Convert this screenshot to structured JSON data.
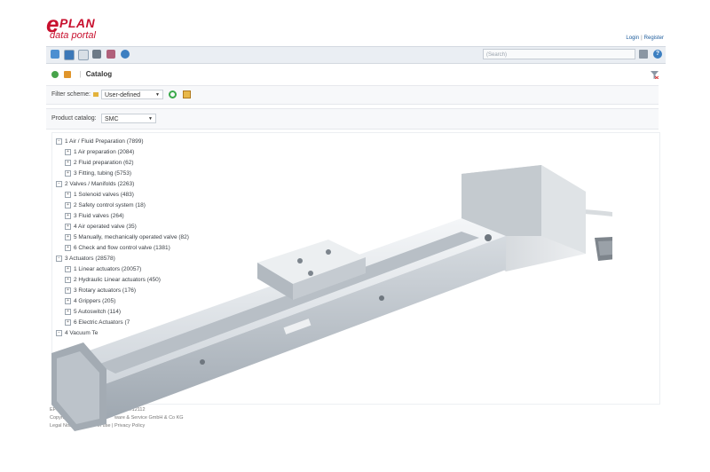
{
  "brand": {
    "logo_e": "e",
    "logo_plan": "PLAN",
    "logo_sub": "data portal"
  },
  "auth": {
    "login": "Login",
    "register": "Register"
  },
  "toolbar": {
    "icons": [
      "chart-icon",
      "catalog-icon",
      "table-icon",
      "binoculars-icon",
      "factory-icon",
      "info-icon"
    ],
    "search_placeholder": "(Search)",
    "help_label": "?"
  },
  "breadcrumb": {
    "current": "Catalog"
  },
  "filter": {
    "label": "Filter scheme:",
    "value": "User-defined"
  },
  "product_catalog": {
    "label": "Product catalog:",
    "value": "SMC"
  },
  "tree": [
    {
      "label": "1 Air / Fluid Preparation (7899)",
      "level": 0,
      "box": "−"
    },
    {
      "label": "1 Air preparation (2084)",
      "level": 1,
      "box": "+"
    },
    {
      "label": "2 Fluid preparation (62)",
      "level": 1,
      "box": "+"
    },
    {
      "label": "3 Fitting, tubing (5753)",
      "level": 1,
      "box": "+"
    },
    {
      "label": "2 Valves / Manifolds (2263)",
      "level": 0,
      "box": "−"
    },
    {
      "label": "1 Solenoid valves (483)",
      "level": 1,
      "box": "+"
    },
    {
      "label": "2 Safety control system (18)",
      "level": 1,
      "box": "+"
    },
    {
      "label": "3 Fluid valves (264)",
      "level": 1,
      "box": "+"
    },
    {
      "label": "4 Air operated valve (35)",
      "level": 1,
      "box": "+"
    },
    {
      "label": "5 Manually, mechanically operated valve (82)",
      "level": 1,
      "box": "+"
    },
    {
      "label": "6 Check and flow control valve (1381)",
      "level": 1,
      "box": "+"
    },
    {
      "label": "3 Actuators (28578)",
      "level": 0,
      "box": "−"
    },
    {
      "label": "1 Linear actuators (20057)",
      "level": 1,
      "box": "+"
    },
    {
      "label": "2 Hydraulic Linear actuators (450)",
      "level": 1,
      "box": "+"
    },
    {
      "label": "3 Rotary actuators (176)",
      "level": 1,
      "box": "+"
    },
    {
      "label": "4 Grippers (205)",
      "level": 1,
      "box": "+"
    },
    {
      "label": "5 Autoswitch (114)",
      "level": 1,
      "box": "+"
    },
    {
      "label": "6 Electric Actuators (7",
      "level": 1,
      "box": "+"
    },
    {
      "label": "4 Vacuum Te",
      "level": 0,
      "box": "−"
    }
  ],
  "footer": {
    "line1": "EPLAN",
    "line1b": "4.12112",
    "line2": "Copyrig",
    "line2b": "ware & Service GmbH & Co KG",
    "line3a": "Legal Notic",
    "line3b": "of use",
    "line3c": "Privacy Policy"
  },
  "colors": {
    "brand": "#c8102e",
    "link": "#1c5b9b",
    "toolbar_bg": "#eaeef3"
  }
}
